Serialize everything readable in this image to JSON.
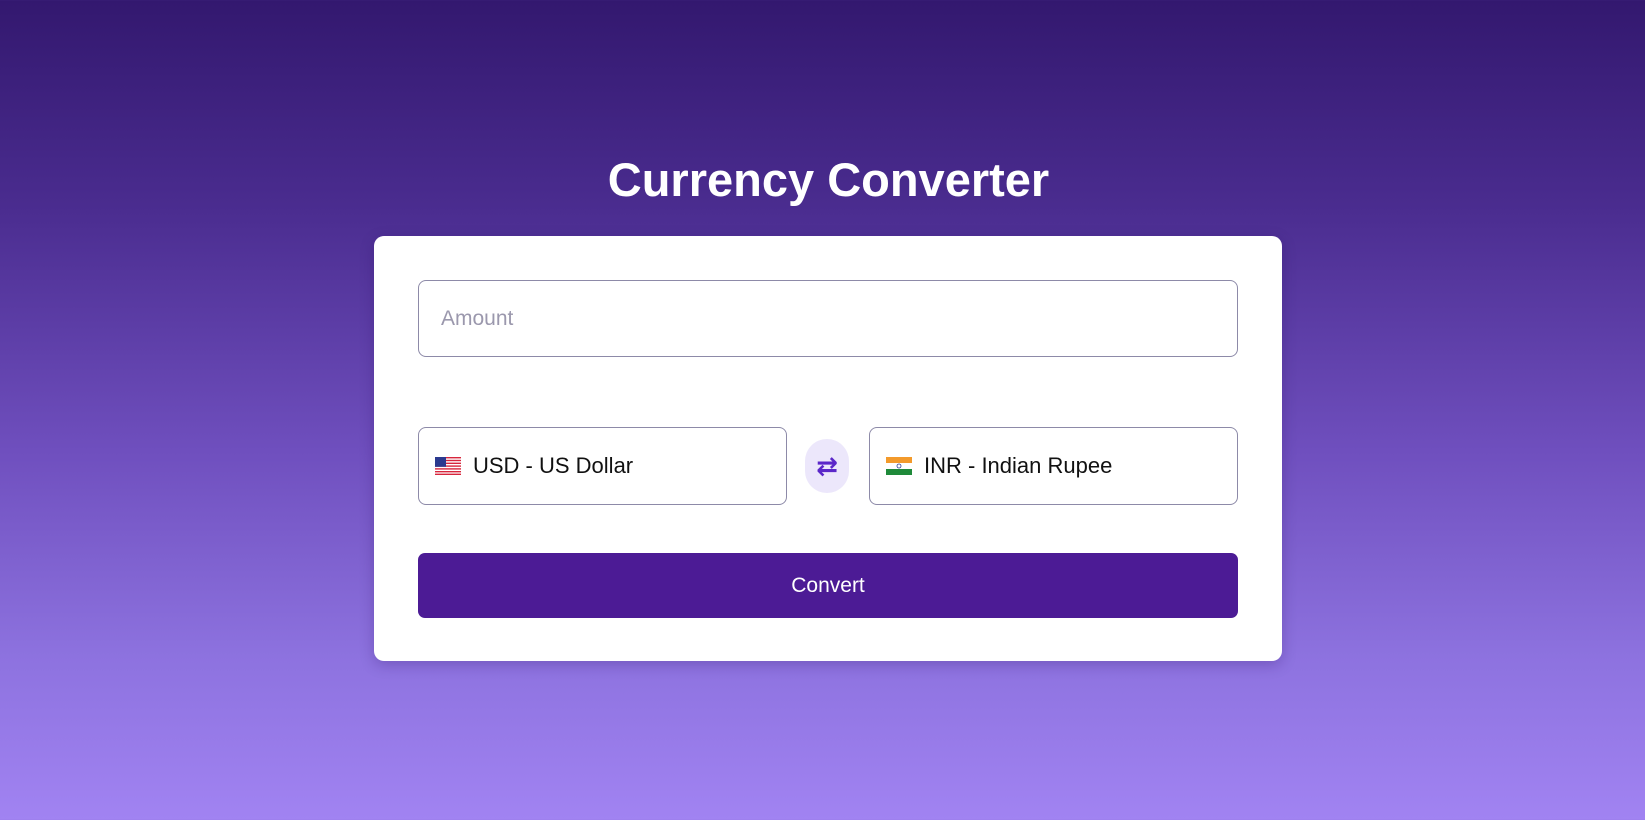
{
  "header": {
    "title": "Currency Converter"
  },
  "form": {
    "amount": {
      "placeholder": "Amount",
      "value": ""
    },
    "from_currency": {
      "label": "USD - US Dollar",
      "flag_icon": "us-flag-icon"
    },
    "swap": {
      "icon": "swap-arrows-icon",
      "glyph": "⇄"
    },
    "to_currency": {
      "label": "INR - Indian Rupee",
      "flag_icon": "india-flag-icon"
    },
    "convert_label": "Convert"
  },
  "colors": {
    "accent": "#4c1b95",
    "swap_icon": "#5b27c9",
    "background_top": "#33186f",
    "background_bottom": "#a183f2"
  }
}
